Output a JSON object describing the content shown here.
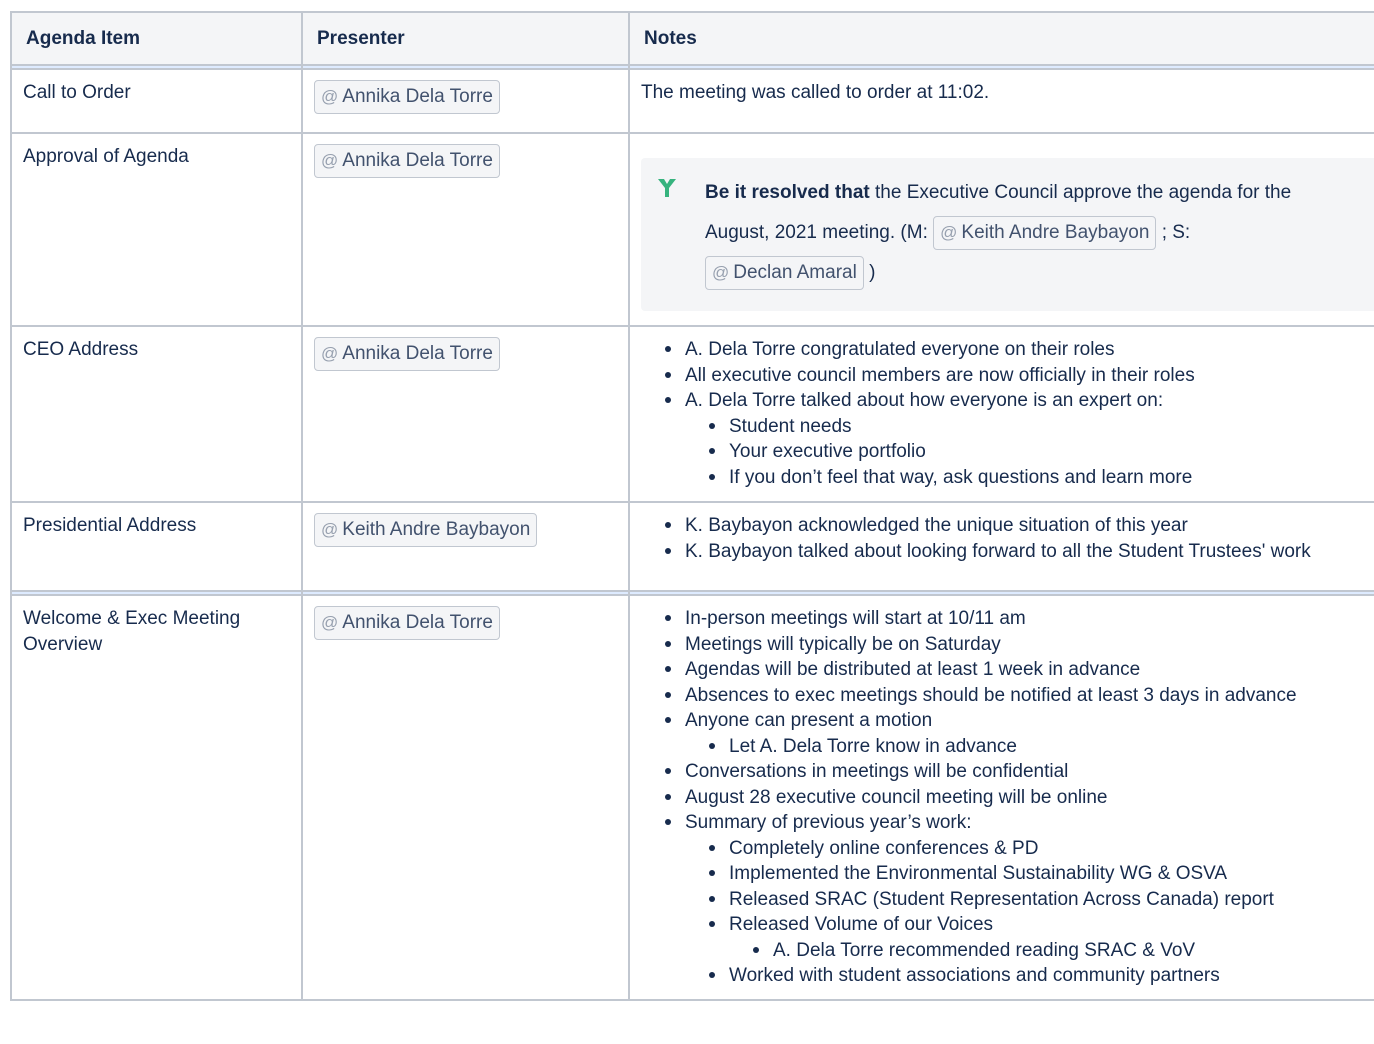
{
  "table": {
    "headers": [
      "Agenda Item",
      "Presenter",
      "Notes"
    ],
    "rows": [
      {
        "item": "Call to Order",
        "presenter": "Annika Dela Torre",
        "note_text": "The meeting was called to order at 11:02."
      },
      {
        "item": "Approval of Agenda",
        "presenter": "Annika Dela Torre",
        "decision": {
          "bold": "Be it resolved that",
          "text1": " the Executive Council approve the agenda for the August, 2021 meeting. (M: ",
          "mention_m": "Keith Andre Baybayon",
          "text2": " ; S: ",
          "mention_s": "Declan Amaral",
          "text3": " )"
        }
      },
      {
        "item": "CEO Address",
        "presenter": "Annika Dela Torre",
        "bullets": [
          "A. Dela Torre congratulated everyone on their roles",
          "All executive council members are now officially in their roles",
          "A. Dela Torre talked about how everyone is an expert on:"
        ],
        "sub_bullets": [
          "Student needs",
          "Your executive portfolio",
          "If you don’t feel that way, ask questions and learn more"
        ]
      },
      {
        "item": "Presidential Address",
        "presenter": "Keith Andre Baybayon",
        "bullets": [
          "K. Baybayon acknowledged the unique situation of this year",
          "K. Baybayon talked about looking forward to all the Student Trustees' work"
        ]
      },
      {
        "item": "Welcome & Exec Meeting Overview",
        "presenter": "Annika Dela Torre",
        "bullets": [
          "In-person meetings will start at 10/11 am",
          "Meetings will typically be on Saturday",
          "Agendas will be distributed at least 1 week in advance",
          "Absences to exec meetings should be notified at least 3 days in advance",
          "Anyone can present a motion",
          "Let A. Dela Torre know in advance",
          "Conversations in meetings will be confidential",
          "August 28 executive council meeting will be online",
          "Summary of previous year’s work:",
          "Completely online conferences & PD",
          "Implemented the Environmental Sustainability WG & OSVA",
          "Released SRAC (Student Representation Across Canada) report",
          "Released Volume of our Voices",
          "A. Dela Torre recommended reading SRAC & VoV",
          "Worked with student associations and community partners"
        ]
      }
    ]
  },
  "mention_symbol": "@",
  "icon": "decision-icon"
}
